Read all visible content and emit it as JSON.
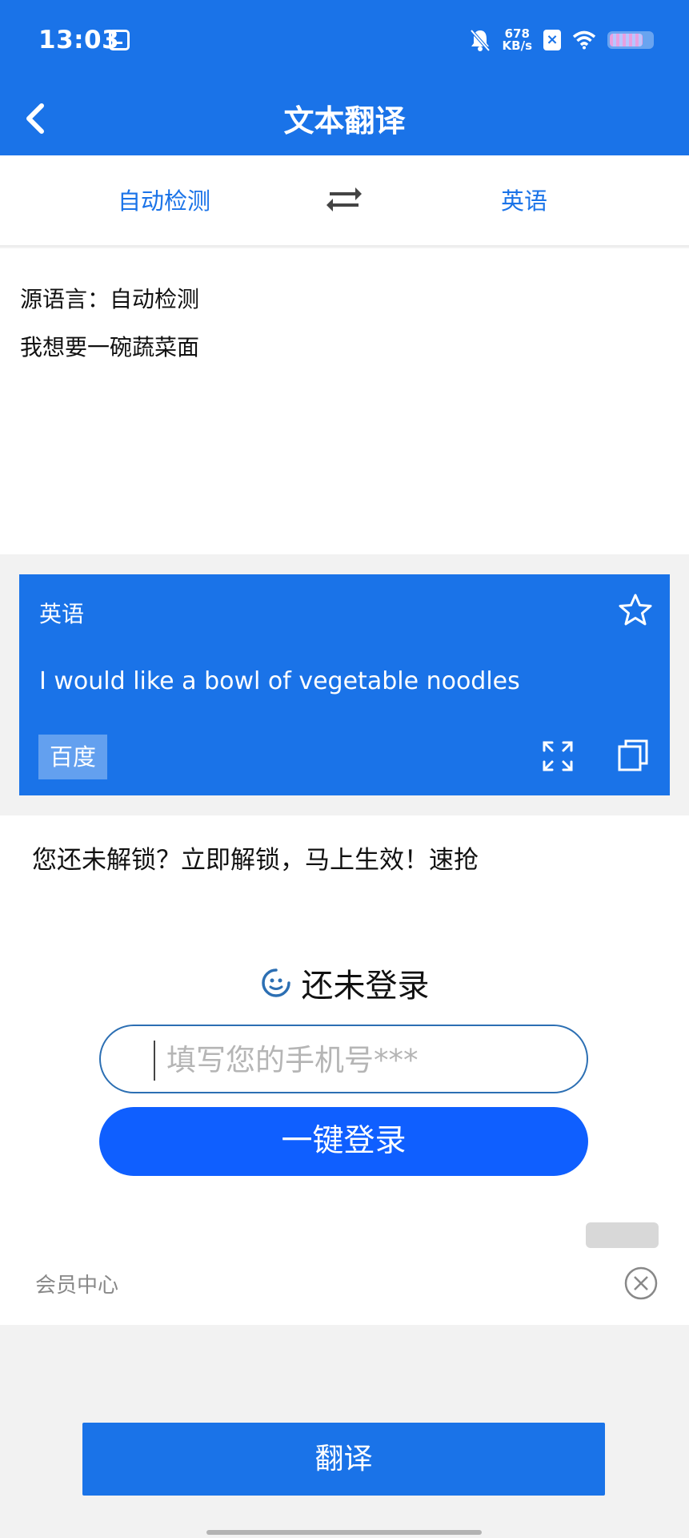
{
  "status_bar": {
    "time": "13:03",
    "net_speed_value": "678",
    "net_speed_unit": "KB/s",
    "icons": [
      "calendar-icon",
      "mute-bell-icon",
      "sim-x-icon",
      "wifi-icon",
      "battery-icon"
    ]
  },
  "header": {
    "title": "文本翻译"
  },
  "languages": {
    "source": "自动检测",
    "target": "英语"
  },
  "source": {
    "label": "源语言：自动检测",
    "text": "我想要一碗蔬菜面"
  },
  "result": {
    "language": "英语",
    "text": "I would like a bowl of vegetable noodles",
    "engine": "百度"
  },
  "promo": {
    "text": "您还未解锁？立即解锁，马上生效！速抢",
    "login_title": "还未登录",
    "phone_placeholder": "填写您的手机号***",
    "login_button": "一键登录",
    "member_center": "会员中心"
  },
  "footer": {
    "translate_button": "翻译"
  },
  "colors": {
    "primary": "#1a73e8",
    "login_button": "#0f5fff"
  }
}
